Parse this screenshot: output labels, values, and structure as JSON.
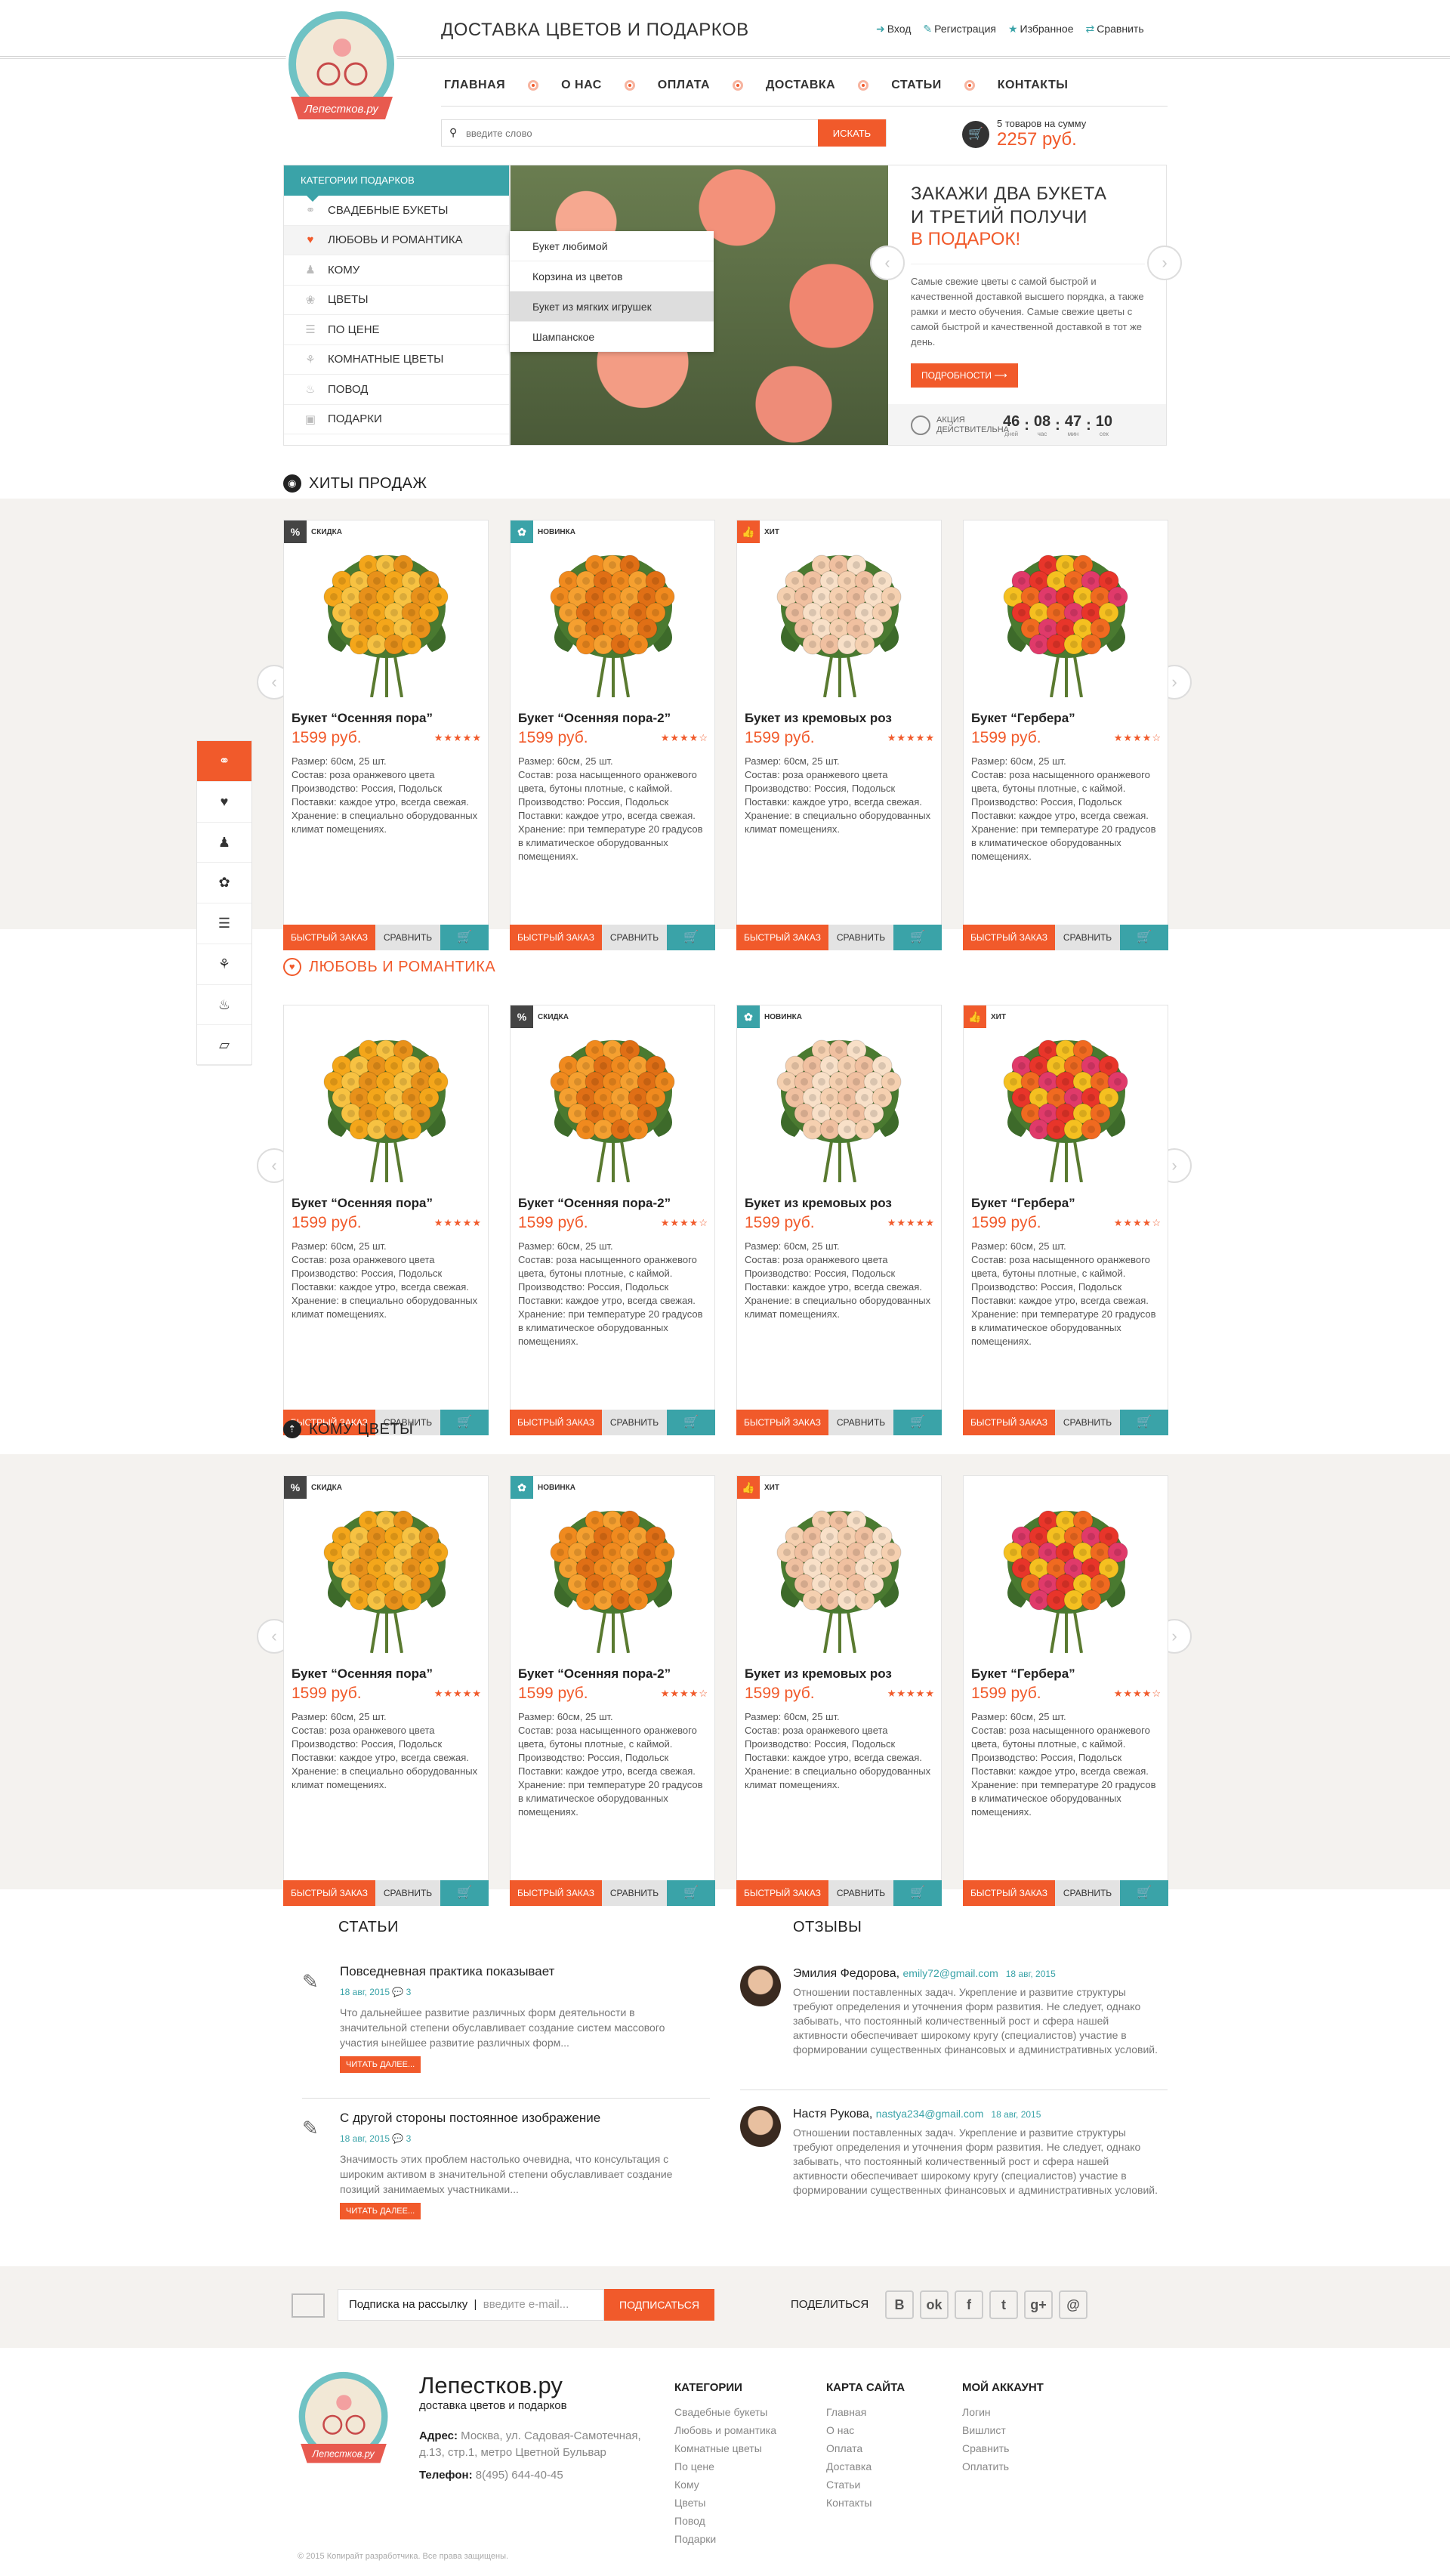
{
  "header": {
    "title": "ДОСТАВКА ЦВЕТОВ И ПОДАРКОВ",
    "logo_text": "Лепестков.ру",
    "links": [
      {
        "icon": "login-icon",
        "label": "Вход"
      },
      {
        "icon": "register-icon",
        "label": "Регистрация"
      },
      {
        "icon": "star-icon",
        "label": "Избранное"
      },
      {
        "icon": "compare-icon",
        "label": "Сравнить"
      }
    ],
    "nav": [
      "ГЛАВНАЯ",
      "О НАС",
      "ОПЛАТА",
      "ДОСТАВКА",
      "СТАТЬИ",
      "КОНТАКТЫ"
    ],
    "search_placeholder": "введите слово",
    "search_button": "ИСКАТЬ",
    "cart_count": "5 товаров на сумму",
    "cart_total": "2257 руб."
  },
  "categories": {
    "title": "КАТЕГОРИИ ПОДАРКОВ",
    "items": [
      "СВАДЕБНЫЕ БУКЕТЫ",
      "ЛЮБОВЬ И РОМАНТИКА",
      "КОМУ",
      "ЦВЕТЫ",
      "ПО ЦЕНЕ",
      "КОМНАТНЫЕ ЦВЕТЫ",
      "ПОВОД",
      "ПОДАРКИ"
    ],
    "active": 1
  },
  "submenu": [
    "Букет любимой",
    "Корзина из цветов",
    "Букет из мягких игрушек",
    "Шампанское"
  ],
  "promo": {
    "line1": "ЗАКАЖИ ДВА БУКЕТА",
    "line2": "И ТРЕТИЙ ПОЛУЧИ",
    "accent": "В ПОДАРОК!",
    "text": "Самые свежие цветы с самой быстрой и качественной доставкой высшего порядка, а также рамки и место обучения. Самые свежие цветы с самой быстрой и качественной доставкой в тот же день.",
    "button": "ПОДРОБНОСТИ ⟶",
    "timer_label": "АКЦИЯ ДЕЙСТВИТЕЛЬНА",
    "timer": [
      {
        "v": "46",
        "u": "дней"
      },
      {
        "v": "08",
        "u": "час"
      },
      {
        "v": "47",
        "u": "мин"
      },
      {
        "v": "10",
        "u": "сек"
      }
    ]
  },
  "sections": [
    {
      "title": "ХИТЫ ПРОДАЖ",
      "products": [
        {
          "badge": "СКИДКА",
          "badge_icon": "%",
          "name": "Букет “Осенняя пора”",
          "price": "1599 руб.",
          "stars": "★★★★★",
          "desc": "Размер: 60см, 25 шт.\nСостав: роза оранжевого цвета\nПроизводство: Россия, Подольск\nПоставки: каждое утро, всегда свежая.\nХранение: в специально оборудованных климат помещениях."
        },
        {
          "badge": "НОВИНКА",
          "badge_icon": "✿",
          "name": "Букет “Осенняя пора-2”",
          "price": "1599 руб.",
          "stars": "★★★★☆",
          "desc": "Размер: 60см, 25 шт.\nСостав: роза насыщенного оранжевого цвета, бутоны плотные, с каймой.\nПроизводство: Россия, Подольск\nПоставки: каждое утро, всегда свежая.\nХранение: при температуре 20 градусов в климатическое оборудованных помещениях."
        },
        {
          "badge": "ХИТ",
          "badge_icon": "👍",
          "name": "Букет из кремовых роз",
          "price": "1599 руб.",
          "stars": "★★★★★",
          "desc": "Размер: 60см, 25 шт.\nСостав: роза оранжевого цвета\nПроизводство: Россия, Подольск\nПоставки: каждое утро, всегда свежая.\nХранение: в специально оборудованных климат помещениях."
        },
        {
          "badge": "",
          "badge_icon": "",
          "name": "Букет “Гербера”",
          "price": "1599 руб.",
          "stars": "★★★★☆",
          "desc": "Размер: 60см, 25 шт.\nСостав: роза насыщенного оранжевого цвета, бутоны плотные, с каймой.\nПроизводство: Россия, Подольск\nПоставки: каждое утро, всегда свежая.\nХранение: при температуре 20 градусов в климатическое оборудованных помещениях."
        }
      ]
    },
    {
      "title": "ЛЮБОВЬ И РОМАНТИКА",
      "products": [
        {
          "badge": "",
          "badge_icon": "",
          "name": "Букет “Осенняя пора”",
          "price": "1599 руб.",
          "stars": "★★★★★",
          "desc": "Размер: 60см, 25 шт.\nСостав: роза оранжевого цвета\nПроизводство: Россия, Подольск\nПоставки: каждое утро, всегда свежая.\nХранение: в специально оборудованных климат помещениях."
        },
        {
          "badge": "СКИДКА",
          "badge_icon": "%",
          "name": "Букет “Осенняя пора-2”",
          "price": "1599 руб.",
          "stars": "★★★★☆",
          "desc": "Размер: 60см, 25 шт.\nСостав: роза насыщенного оранжевого цвета, бутоны плотные, с каймой.\nПроизводство: Россия, Подольск\nПоставки: каждое утро, всегда свежая.\nХранение: при температуре 20 градусов в климатическое оборудованных помещениях."
        },
        {
          "badge": "НОВИНКА",
          "badge_icon": "✿",
          "name": "Букет из кремовых роз",
          "price": "1599 руб.",
          "stars": "★★★★★",
          "desc": "Размер: 60см, 25 шт.\nСостав: роза оранжевого цвета\nПроизводство: Россия, Подольск\nПоставки: каждое утро, всегда свежая.\nХранение: в специально оборудованных климат помещениях."
        },
        {
          "badge": "ХИТ",
          "badge_icon": "👍",
          "name": "Букет “Гербера”",
          "price": "1599 руб.",
          "stars": "★★★★☆",
          "desc": "Размер: 60см, 25 шт.\nСостав: роза насыщенного оранжевого цвета, бутоны плотные, с каймой.\nПроизводство: Россия, Подольск\nПоставки: каждое утро, всегда свежая.\nХранение: при температуре 20 градусов в климатическое оборудованных помещениях."
        }
      ]
    },
    {
      "title": "КОМУ ЦВЕТЫ",
      "products": [
        {
          "badge": "СКИДКА",
          "badge_icon": "%",
          "name": "Букет “Осенняя пора”",
          "price": "1599 руб.",
          "stars": "★★★★★",
          "desc": "Размер: 60см, 25 шт.\nСостав: роза оранжевого цвета\nПроизводство: Россия, Подольск\nПоставки: каждое утро, всегда свежая.\nХранение: в специально оборудованных климат помещениях."
        },
        {
          "badge": "НОВИНКА",
          "badge_icon": "✿",
          "name": "Букет “Осенняя пора-2”",
          "price": "1599 руб.",
          "stars": "★★★★☆",
          "desc": "Размер: 60см, 25 шт.\nСостав: роза насыщенного оранжевого цвета, бутоны плотные, с каймой.\nПроизводство: Россия, Подольск\nПоставки: каждое утро, всегда свежая.\nХранение: при температуре 20 градусов в климатическое оборудованных помещениях."
        },
        {
          "badge": "ХИТ",
          "badge_icon": "👍",
          "name": "Букет из кремовых роз",
          "price": "1599 руб.",
          "stars": "★★★★★",
          "desc": "Размер: 60см, 25 шт.\nСостав: роза оранжевого цвета\nПроизводство: Россия, Подольск\nПоставки: каждое утро, всегда свежая.\nХранение: в специально оборудованных климат помещениях."
        },
        {
          "badge": "",
          "badge_icon": "",
          "name": "Букет “Гербера”",
          "price": "1599 руб.",
          "stars": "★★★★☆",
          "desc": "Размер: 60см, 25 шт.\nСостав: роза насыщенного оранжевого цвета, бутоны плотные, с каймой.\nПроизводство: Россия, Подольск\nПоставки: каждое утро, всегда свежая.\nХранение: при температуре 20 градусов в климатическое оборудованных помещениях."
        }
      ]
    }
  ],
  "card_buttons": {
    "quick": "БЫСТРЫЙ ЗАКАЗ",
    "compare": "СРАВНИТЬ"
  },
  "articles": {
    "title": "СТАТЬИ",
    "items": [
      {
        "title": "Повседневная практика показывает",
        "date": "18 авг, 2015",
        "comments": "3",
        "text": "Что дальнейшее развитие различных форм деятельности в значительной степени обуславливает создание систем массового участия ынейшее развитие различных форм...",
        "more": "ЧИТАТЬ ДАЛЕЕ..."
      },
      {
        "title": "С другой стороны постоянное изображение",
        "date": "18 авг, 2015",
        "comments": "3",
        "text": "Значимость этих проблем настолько очевидна, что консультация с широким активом в значительной степени обуславливает создание позиций занимаемых участниками...",
        "more": "ЧИТАТЬ ДАЛЕЕ..."
      }
    ]
  },
  "reviews": {
    "title": "ОТЗЫВЫ",
    "items": [
      {
        "name": "Эмилия Федорова,",
        "email": "emily72@gmail.com",
        "date": "18 авг, 2015",
        "text": "Отношении поставленных задач. Укрепление и развитие структуры требуют определения и уточнения форм развития. Не следует, однако забывать, что постоянный количественный рост и сфера нашей активности обеспечивает широкому кругу (специалистов) участие в формировании существенных финансовых и административных условий."
      },
      {
        "name": "Настя Рукова,",
        "email": "nastya234@gmail.com",
        "date": "18 авг, 2015",
        "text": "Отношении поставленных задач. Укрепление и развитие структуры требуют определения и уточнения форм развития. Не следует, однако забывать, что постоянный количественный рост и сфера нашей активности обеспечивает широкому кругу (специалистов) участие в формировании существенных финансовых и административных условий."
      }
    ]
  },
  "subscribe": {
    "label": "Подписка на рассылку",
    "placeholder": "введите e-mail...",
    "button": "ПОДПИСАТЬСЯ",
    "share": "ПОДЕЛИТЬСЯ",
    "socials": [
      "В",
      "ok",
      "f",
      "t",
      "g+",
      "@"
    ]
  },
  "footer": {
    "name": "Лепестков.ру",
    "sub": "доставка цветов и подарков",
    "addr_label": "Адрес:",
    "addr": "Москва, ул. Садовая-Самотечная, д.13, стр.1, метро Цветной Бульвар",
    "phone_label": "Телефон:",
    "phone": "8(495) 644-40-45",
    "cols": [
      {
        "title": "КАТЕГОРИИ",
        "items": [
          "Свадебные букеты",
          "Любовь и романтика",
          "Комнатные цветы",
          "По цене",
          "Кому",
          "Цветы",
          "Повод",
          "Подарки"
        ]
      },
      {
        "title": "КАРТА САЙТА",
        "items": [
          "Главная",
          "О нас",
          "Оплата",
          "Доставка",
          "Статьи",
          "Контакты"
        ]
      },
      {
        "title": "МОЙ АККАУНТ",
        "items": [
          "Логин",
          "Вишлист",
          "Сравнить",
          "Оплатить"
        ]
      }
    ],
    "copyright": "© 2015 Копирайт разработчика. Все права защищены."
  },
  "colors": {
    "accent": "#f15a2b",
    "teal": "#3aa3a8",
    "band": "#f4f2ef"
  }
}
